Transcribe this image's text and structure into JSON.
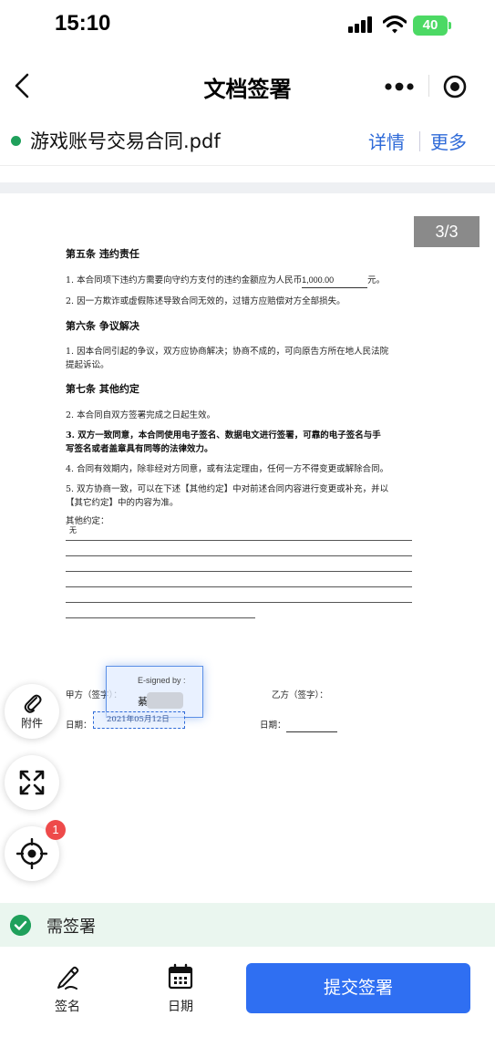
{
  "status_bar": {
    "time": "15:10",
    "battery": "40"
  },
  "nav": {
    "title": "文档签署",
    "back_icon": "chevron-left-icon",
    "more_icon": "more-dots-icon",
    "close_icon": "target-close-icon"
  },
  "file": {
    "name": "游戏账号交易合同.pdf",
    "detail_label": "详情",
    "more_label": "更多"
  },
  "document": {
    "page_indicator": "3/3",
    "sections": {
      "s5_title": "第五条 违约责任",
      "s5_p1_a": "1.    本合同项下违约方需要向守约方支付的违约金额应为人民币",
      "s5_p1_amount": "1,000.00",
      "s5_p1_b": "元。",
      "s5_p2": "2.    因一方欺诈或虚假陈述导致合同无效的，过错方应赔偿对方全部损失。",
      "s6_title": "第六条 争议解决",
      "s6_p1_l1": "1.    因本合同引起的争议，双方应协商解决；协商不成的，可向原告方所在地人民法院",
      "s6_p1_l2": "提起诉讼。",
      "s7_title": "第七条 其他约定",
      "s7_p2": "2.    本合同自双方签署完成之日起生效。",
      "s7_p3_l1": "3.    双方一致同意，本合同使用电子签名、数据电文进行签署，可靠的电子签名与手",
      "s7_p3_l2": "写签名或者盖章具有同等的法律效力。",
      "s7_p4": "4.    合同有效期内，除非经对方同意，或有法定理由，任何一方不得变更或解除合同。",
      "s7_p5_l1": "5.    双方协商一致，可以在下述【其他约定】中对前述合同内容进行变更或补充，并以",
      "s7_p5_l2": "【其它约定】中的内容为准。",
      "other_label": "其他约定：",
      "other_value": "无"
    },
    "party_a_label": "甲方（签字）：",
    "party_b_label": "乙方（签字）：",
    "date_label_a": "日期：",
    "date_label_b": "日期：",
    "signature": {
      "label": "E-signed by :",
      "name_visible": "綦"
    },
    "signed_date": "2021年05月12日"
  },
  "floating": {
    "attach_label": "附件",
    "locate_badge": "1"
  },
  "status_strip": {
    "label": "需签署"
  },
  "bottom": {
    "sign_label": "签名",
    "date_label": "日期",
    "submit_label": "提交签署"
  },
  "colors": {
    "accent": "#2f6ff2",
    "link": "#2e6ad8",
    "success": "#1fa05b",
    "badge": "#ee4a4a"
  }
}
